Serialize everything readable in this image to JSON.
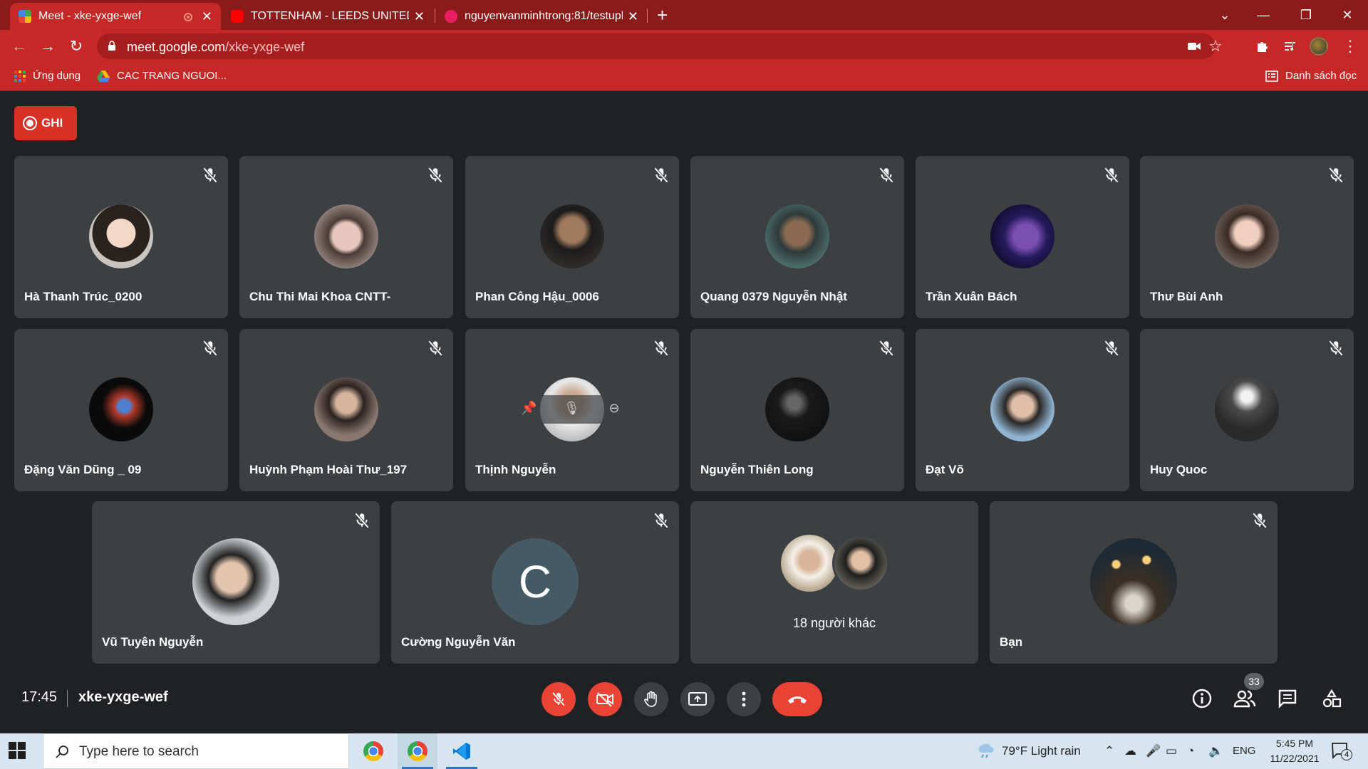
{
  "browser": {
    "tabs": [
      {
        "title": "Meet - xke-yxge-wef",
        "active": true,
        "recording": true
      },
      {
        "title": "TOTTENHAM - LEEDS UNITED: SU",
        "active": false
      },
      {
        "title": "nguyenvanminhtrong:81/testupl",
        "active": false
      }
    ],
    "url_host": "meet.google.com",
    "url_path": "/xke-yxge-wef",
    "bookmarks": [
      "Ứng dụng",
      "CAC TRANG NGUOI..."
    ],
    "reading_list": "Danh sách đọc"
  },
  "meeting": {
    "record_label": "GHI",
    "time": "17:45",
    "code": "xke-yxge-wef",
    "participant_count": "33",
    "row1": [
      {
        "name": "Hà Thanh Trúc_0200"
      },
      {
        "name": "Chu Thi Mai Khoa CNTT-"
      },
      {
        "name": "Phan Công Hậu_0006"
      },
      {
        "name": "Quang 0379 Nguyễn Nhật"
      },
      {
        "name": "Trần Xuân Bách"
      },
      {
        "name": "Thư Bùi Anh"
      }
    ],
    "row2": [
      {
        "name": "Đặng Văn Dũng _ 09"
      },
      {
        "name": "Huỳnh Phạm Hoài Thư_197"
      },
      {
        "name": "Thịnh Nguyễn"
      },
      {
        "name": "Nguyễn Thiên Long"
      },
      {
        "name": "Đạt Võ"
      },
      {
        "name": "Huy Quoc"
      }
    ],
    "row3": [
      {
        "name": "Vũ Tuyên Nguyễn"
      },
      {
        "name": "Cường Nguyễn Văn",
        "initial": "C"
      },
      {
        "others_label": "18 người khác"
      },
      {
        "name": "Bạn"
      }
    ]
  },
  "taskbar": {
    "search_placeholder": "Type here to search",
    "weather": "79°F  Light rain",
    "language": "ENG",
    "time": "5:45 PM",
    "date": "11/22/2021",
    "notifications": "4"
  },
  "colors": {
    "chrome_dark": "#8b1a1a",
    "chrome": "#c62828",
    "meet_bg": "#202124",
    "tile_bg": "#3c4043",
    "danger": "#ea4335"
  }
}
